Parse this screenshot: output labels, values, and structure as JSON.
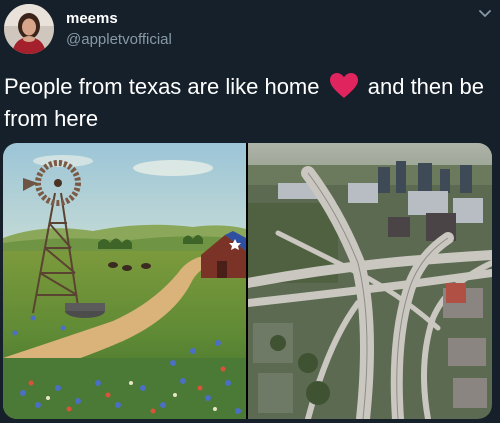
{
  "tweet": {
    "display_name": "meems",
    "handle": "@appletvofficial",
    "text_before": "People from texas are like home",
    "text_after": "and then be from here",
    "emoji": "red-heart"
  },
  "icons": {
    "menu": "chevron-down-icon"
  },
  "media": {
    "left_image": "painting-texas-windmill-barn-bluebonnets",
    "right_image": "aerial-highway-interchange-city"
  },
  "colors": {
    "background": "#15202b",
    "secondary_text": "#8899a6",
    "heart": "#e0245e"
  }
}
